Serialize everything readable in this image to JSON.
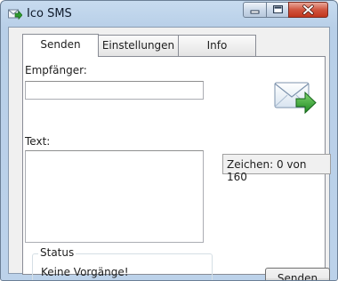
{
  "window": {
    "title": "Ico SMS",
    "icon": "sms-app-icon"
  },
  "titlebar_buttons": [
    "minimize",
    "maximize",
    "close"
  ],
  "tabs": [
    {
      "label": "Senden",
      "active": true
    },
    {
      "label": "Einstellungen",
      "active": false
    },
    {
      "label": "Info",
      "active": false
    }
  ],
  "form": {
    "recipient_label": "Empfänger:",
    "recipient_value": "",
    "text_label": "Text:",
    "text_value": "",
    "char_counter": "Zeichen: 0 von 160"
  },
  "status": {
    "title": "Status",
    "message": "Keine Vorgänge!"
  },
  "send_button": "Senden",
  "colors": {
    "window_frame": "#b9d1ea",
    "close_button": "#c7432b",
    "envelope_arrow": "#2e9b2e"
  }
}
